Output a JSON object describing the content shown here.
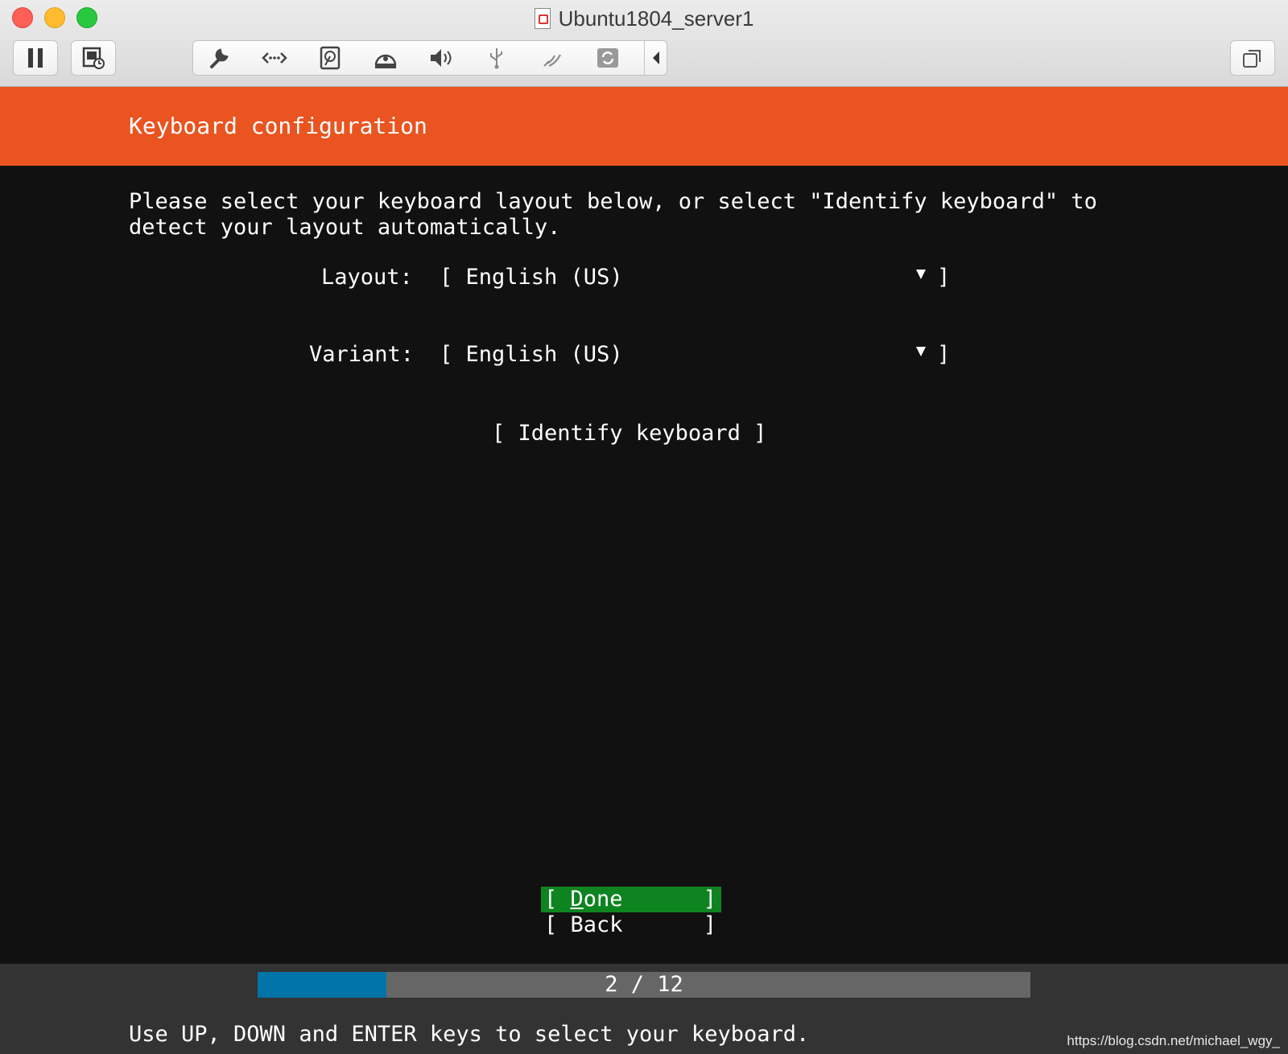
{
  "window": {
    "title": "Ubuntu1804_server1",
    "toolbar_icons": [
      "pause-icon",
      "snapshot-icon",
      "settings-wrench-icon",
      "network-icon",
      "hard-disk-icon",
      "cd-dvd-icon",
      "sound-icon",
      "usb-icon",
      "serial-port-icon",
      "shared-folders-icon",
      "collapse-arrow-icon",
      "fullscreen-icon"
    ]
  },
  "installer": {
    "banner_title": "Keyboard configuration",
    "instruction_line1": "Please select your keyboard layout below, or select \"Identify keyboard\" to",
    "instruction_line2": "detect your layout automatically.",
    "layout_label": "Layout:",
    "layout_value": "[ English (US)",
    "layout_close": "]",
    "variant_label": "Variant:",
    "variant_value": "[ English (US)",
    "variant_close": "]",
    "identify_button": "[ Identify keyboard ]",
    "done_open": "[ ",
    "done_hotkey": "D",
    "done_rest": "one",
    "done_close": "]",
    "back_label": "[ Back",
    "back_close": "]",
    "progress_text": "2 / 12",
    "progress_fraction": 0.1667,
    "help_text": "Use UP, DOWN and ENTER keys to select your keyboard.",
    "accent_color": "#e95420",
    "selected_color": "#0e8420",
    "progress_color": "#0073a8"
  },
  "watermark": "https://blog.csdn.net/michael_wgy_"
}
